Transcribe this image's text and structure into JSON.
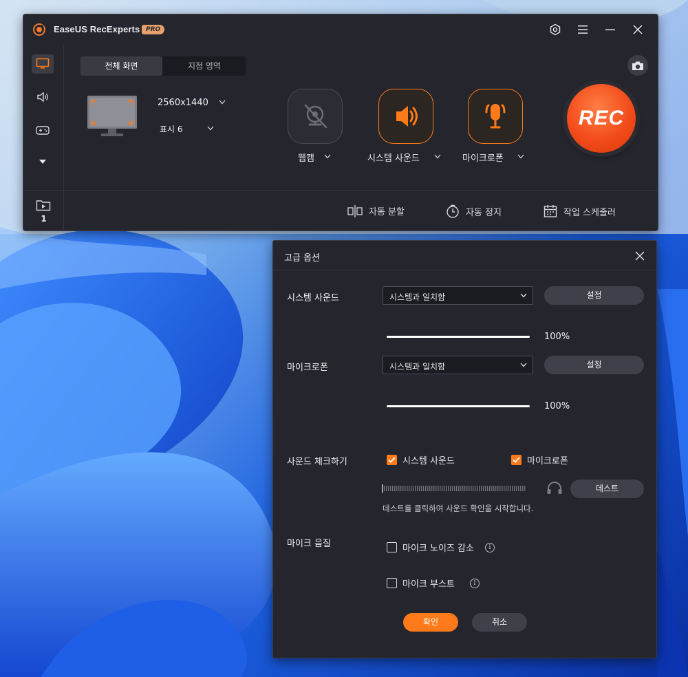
{
  "app": {
    "title": "EaseUS RecExperts",
    "badge": "PRO"
  },
  "capture": {
    "tabs": [
      "전체 화면",
      "지정 영역"
    ],
    "active_tab": "전체 화면",
    "resolution": "2560x1440",
    "display": "표시 6"
  },
  "sources": {
    "webcam": {
      "label": "웹캠",
      "enabled": false
    },
    "system_sound": {
      "label": "시스템 사운드",
      "enabled": true
    },
    "microphone": {
      "label": "마이크로폰",
      "enabled": true
    }
  },
  "rec_label": "REC",
  "sidebar": {
    "items": [
      {
        "icon": "monitor-icon",
        "active": true
      },
      {
        "icon": "speaker-icon",
        "active": false
      },
      {
        "icon": "gamepad-icon",
        "active": false
      },
      {
        "icon": "triangle-down-icon",
        "active": false
      }
    ],
    "recordings_count": "1"
  },
  "bottom_bar": {
    "auto_split": "자동 분할",
    "auto_stop": "자동 정지",
    "task_scheduler": "작업 스케줄러"
  },
  "dialog": {
    "title": "고급 옵션",
    "system_sound": {
      "label": "시스템 사운드",
      "device": "시스템과 일치함",
      "settings_button": "설정",
      "volume": 1.0,
      "volume_text": "100%"
    },
    "microphone": {
      "label": "마이크로폰",
      "device": "시스템과 일치함",
      "settings_button": "설정",
      "volume": 1.0,
      "volume_text": "100%"
    },
    "sound_check": {
      "label": "사운드 체크하기",
      "system_sound_option": "시스템 사운드",
      "system_sound_checked": true,
      "microphone_option": "마이크로폰",
      "microphone_checked": true,
      "test_button": "데스트",
      "hint": "데스트를 클릭하여 사운드 확인을 시작합니다."
    },
    "mic_quality": {
      "label": "마이크 음질",
      "noise_reduction": "마이크 노이즈 감소",
      "noise_reduction_checked": false,
      "boost": "마이크 부스트",
      "boost_checked": false
    },
    "ok_button": "확인",
    "cancel_button": "취소"
  },
  "colors": {
    "accent": "#ff7a1a",
    "window_bg": "#25262d",
    "rec_red": "#f24c1a"
  }
}
